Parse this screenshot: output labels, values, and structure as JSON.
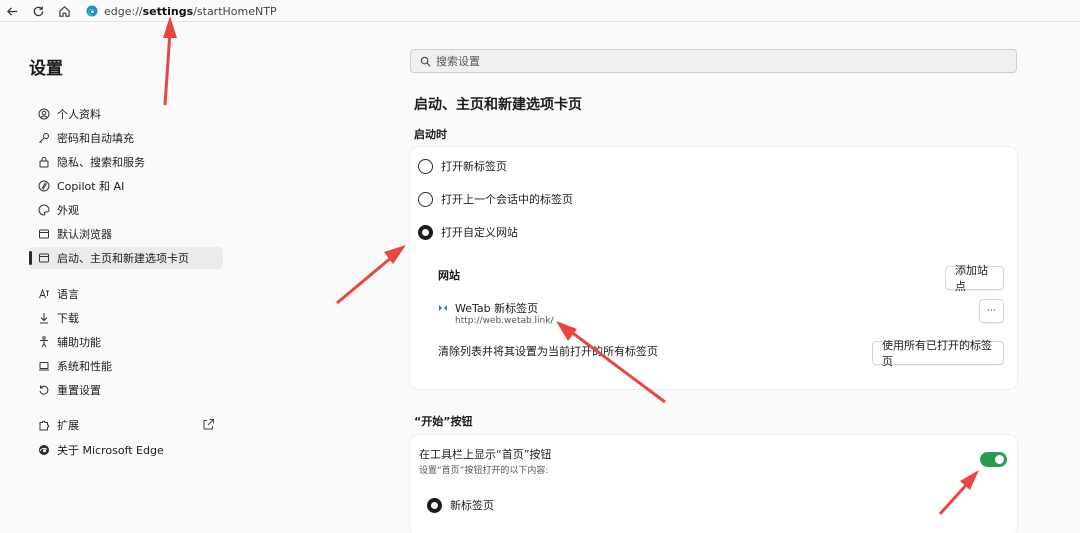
{
  "browser": {
    "url_prefix": "edge://",
    "url_bold": "settings",
    "url_suffix": "/startHomeNTP"
  },
  "sidebar": {
    "title": "设置",
    "items": [
      {
        "label": "个人资料",
        "icon": "profile-icon"
      },
      {
        "label": "密码和自动填充",
        "icon": "key-icon"
      },
      {
        "label": "隐私、搜索和服务",
        "icon": "lock-icon"
      },
      {
        "label": "Copilot 和 AI",
        "icon": "copilot-icon"
      },
      {
        "label": "外观",
        "icon": "palette-icon"
      },
      {
        "label": "默认浏览器",
        "icon": "browser-icon"
      },
      {
        "label": "启动、主页和新建选项卡页",
        "icon": "home-page-icon",
        "active": true
      },
      {
        "label": "语言",
        "icon": "language-icon"
      },
      {
        "label": "下载",
        "icon": "download-icon"
      },
      {
        "label": "辅助功能",
        "icon": "accessibility-icon"
      },
      {
        "label": "系统和性能",
        "icon": "laptop-icon"
      },
      {
        "label": "重置设置",
        "icon": "reset-icon"
      },
      {
        "label": "扩展",
        "icon": "puzzle-icon"
      },
      {
        "label": "关于 Microsoft Edge",
        "icon": "edge-icon"
      }
    ]
  },
  "search": {
    "placeholder": "搜索设置"
  },
  "page_title": "启动、主页和新建选项卡页",
  "startup": {
    "heading": "启动时",
    "options": [
      {
        "label": "打开新标签页",
        "selected": false
      },
      {
        "label": "打开上一个会话中的标签页",
        "selected": false
      },
      {
        "label": "打开自定义网站",
        "selected": true
      }
    ],
    "sites_label": "网站",
    "add_site_button": "添加站点",
    "site": {
      "name": "WeTab 新标签页",
      "url": "http://web.wetab.link/"
    },
    "more_button": "···",
    "clear_text": "清除列表并将其设置为当前打开的所有标签页",
    "use_all_button": "使用所有已打开的标签页"
  },
  "home_button": {
    "heading": "“开始”按钮",
    "show_label": "在工具栏上显示“首页”按钮",
    "description": "设置“首页”按钮打开的以下内容:",
    "toggle_on": true,
    "option_label": "新标签页"
  },
  "colors": {
    "toggle": "#2b9b4f",
    "arrow": "#e8473f"
  }
}
